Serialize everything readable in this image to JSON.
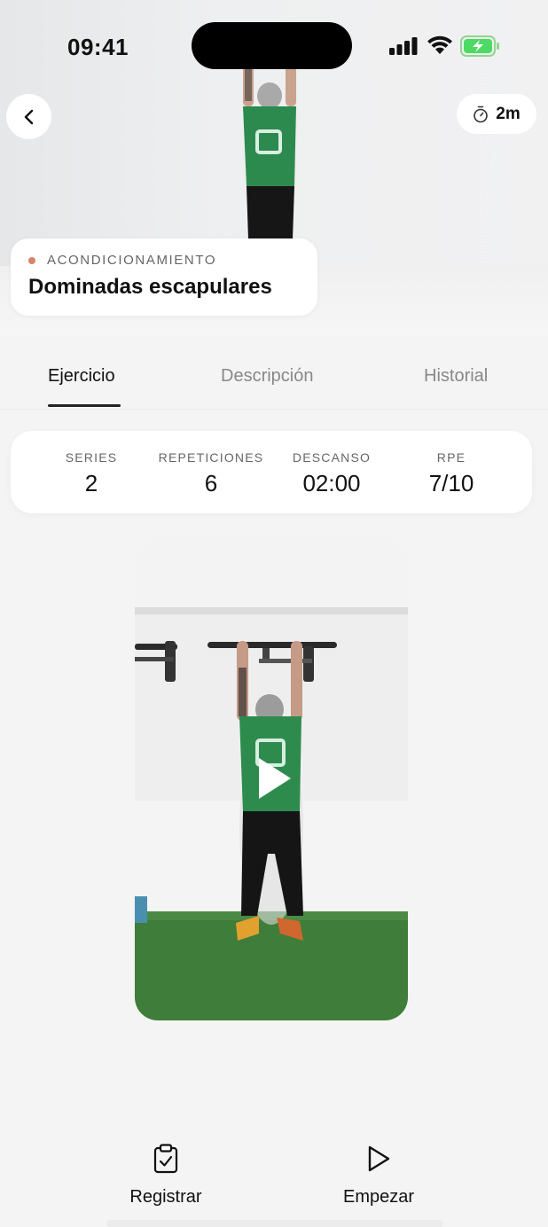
{
  "status_bar": {
    "time": "09:41"
  },
  "header": {
    "timer_label": "2m",
    "category": "ACONDICIONAMIENTO",
    "exercise_name": "Dominadas escapulares"
  },
  "tabs": [
    {
      "label": "Ejercicio",
      "active": true
    },
    {
      "label": "Descripción",
      "active": false
    },
    {
      "label": "Historial",
      "active": false
    }
  ],
  "stats": [
    {
      "label": "SERIES",
      "value": "2"
    },
    {
      "label": "REPETICIONES",
      "value": "6"
    },
    {
      "label": "DESCANSO",
      "value": "02:00"
    },
    {
      "label": "RPE",
      "value": "7/10"
    }
  ],
  "actions": {
    "register_label": "Registrar",
    "start_label": "Empezar"
  },
  "colors": {
    "accent_dot": "#d9826b",
    "battery": "#4cd964",
    "turf": "#3f7d3a",
    "jersey": "#2e8b4e"
  },
  "icons": [
    "chevron-left-icon",
    "stopwatch-icon",
    "play-icon",
    "clipboard-check-icon",
    "play-outline-icon"
  ]
}
